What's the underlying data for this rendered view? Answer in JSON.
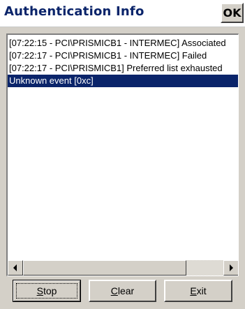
{
  "window": {
    "title": "Authentication Info",
    "ok_label": "OK"
  },
  "log": {
    "rows": [
      {
        "text": "[07:22:15 - PCI\\PRISMICB1 - INTERMEC]  Associated"
      },
      {
        "text": "[07:22:17 - PCI\\PRISMICB1 - INTERMEC]  Failed"
      },
      {
        "text": "[07:22:17 - PCI\\PRISMICB1]  Preferred list exhausted"
      },
      {
        "text": "Unknown event [0xc]",
        "selected": true
      }
    ],
    "scroll_position": 0.0
  },
  "buttons": {
    "stop": {
      "mnemonic": "S",
      "rest": "top"
    },
    "clear": {
      "mnemonic": "C",
      "rest": "lear"
    },
    "exit": {
      "mnemonic": "E",
      "rest": "xit"
    }
  },
  "colors": {
    "title": "#0a246a",
    "selection": "#0a246a",
    "face": "#d4d0c8"
  },
  "icons": {
    "scroll_left": "arrow-left-icon",
    "scroll_right": "arrow-right-icon"
  }
}
